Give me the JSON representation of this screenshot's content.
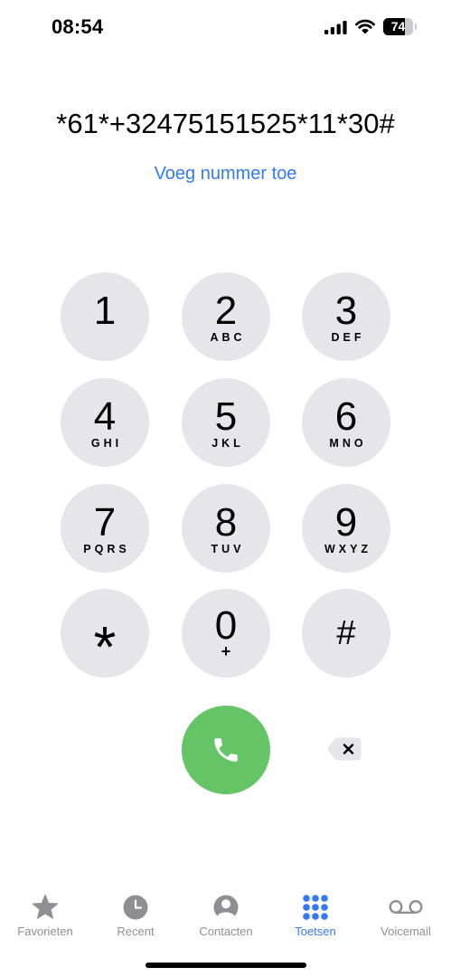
{
  "status_bar": {
    "time": "08:54",
    "battery_percent": "74",
    "icons": [
      "cellular-signal-icon",
      "wifi-icon",
      "battery-icon"
    ]
  },
  "dialer": {
    "number": "*61*+32475151525*11*30#",
    "add_number_label": "Voeg nummer toe"
  },
  "keypad": {
    "keys": [
      {
        "digit": "1"
      },
      {
        "digit": "2",
        "letters": "ABC"
      },
      {
        "digit": "3",
        "letters": "DEF"
      },
      {
        "digit": "4",
        "letters": "GHI"
      },
      {
        "digit": "5",
        "letters": "JKL"
      },
      {
        "digit": "6",
        "letters": "MNO"
      },
      {
        "digit": "7",
        "letters": "PQRS"
      },
      {
        "digit": "8",
        "letters": "TUV"
      },
      {
        "digit": "9",
        "letters": "WXYZ"
      },
      {
        "digit": "*"
      },
      {
        "digit": "0",
        "letters": "+"
      },
      {
        "digit": "#"
      }
    ]
  },
  "actions": {
    "call_icon": "phone-icon",
    "delete_icon": "delete-backspace-icon"
  },
  "tab_bar": {
    "tabs": [
      {
        "label": "Favorieten",
        "icon": "star-icon",
        "active": false
      },
      {
        "label": "Recent",
        "icon": "clock-icon",
        "active": false
      },
      {
        "label": "Contacten",
        "icon": "person-circle-icon",
        "active": false
      },
      {
        "label": "Toetsen",
        "icon": "keypad-icon",
        "active": true
      },
      {
        "label": "Voicemail",
        "icon": "voicemail-icon",
        "active": false
      }
    ]
  },
  "colors": {
    "accent": "#3478f6",
    "call_button": "#65c466",
    "key_background": "#e5e5ea",
    "tab_inactive": "#8e8e93"
  }
}
